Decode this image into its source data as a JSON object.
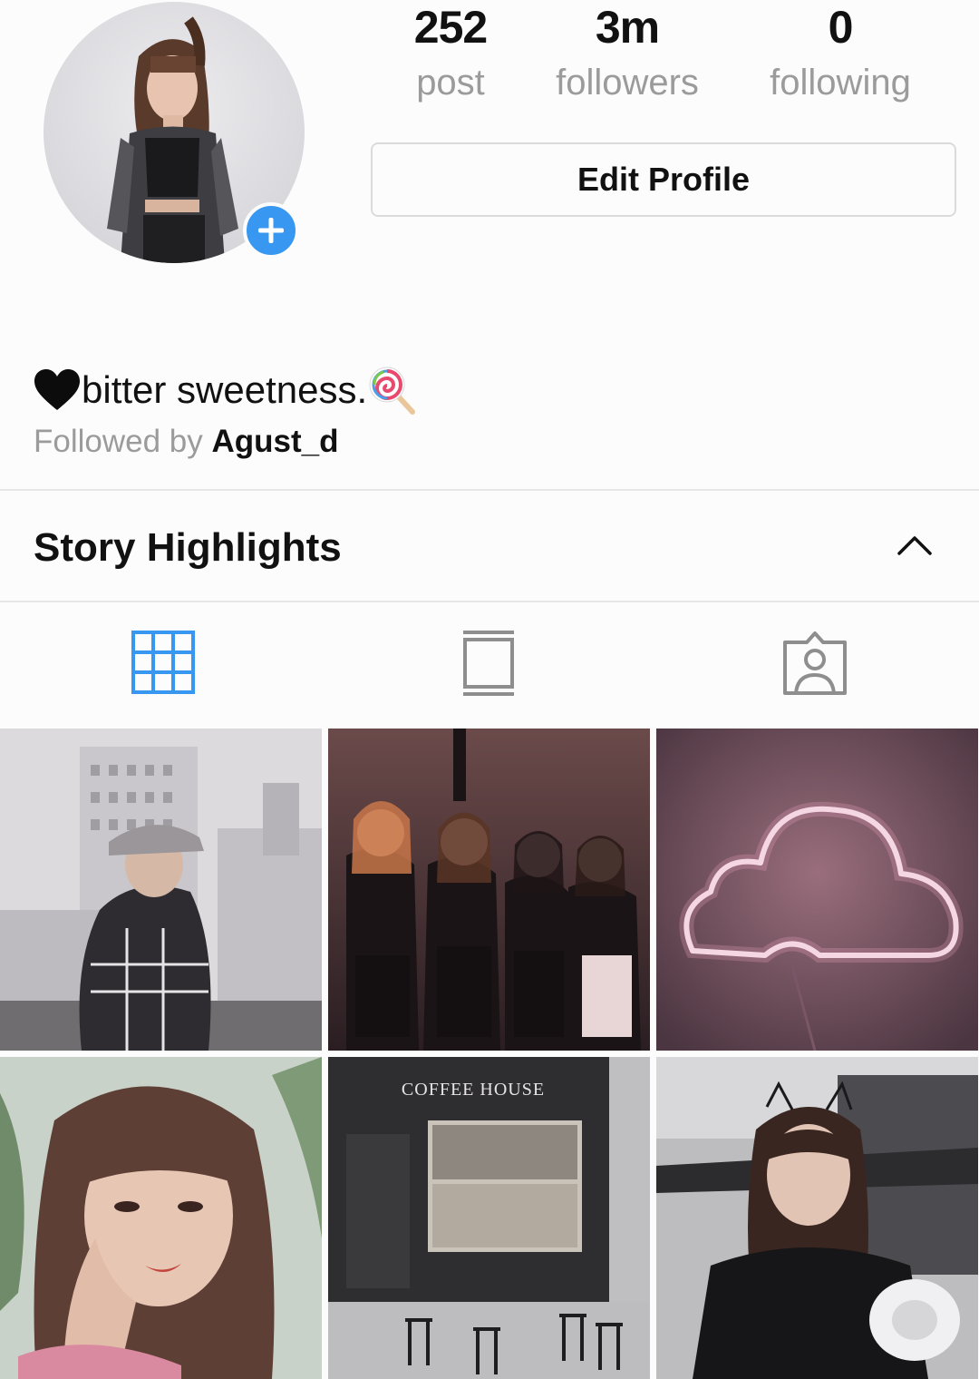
{
  "profile": {
    "stats": {
      "posts_count": "252",
      "posts_label": "post",
      "followers_count": "3m",
      "followers_label": "followers",
      "following_count": "0",
      "following_label": "following"
    },
    "edit_button": "Edit Profile",
    "bio": "bitter sweetness.",
    "bio_prefix_emoji": "black-heart",
    "bio_suffix_emoji": "lollipop",
    "followed_by_prefix": "Followed by ",
    "followed_by_user": "Agust_d"
  },
  "highlights": {
    "title": "Story Highlights",
    "expanded": true
  },
  "tabs": [
    {
      "name": "grid",
      "icon": "grid-icon",
      "active": true
    },
    {
      "name": "igtv",
      "icon": "tv-icon",
      "active": false
    },
    {
      "name": "tagged",
      "icon": "tagged-person-icon",
      "active": false
    }
  ],
  "posts": [
    {
      "description": "woman-in-cap-on-rooftop"
    },
    {
      "description": "group-of-four-performers"
    },
    {
      "description": "neon-cloud-sign"
    },
    {
      "description": "portrait-with-bangs"
    },
    {
      "description": "coffee-house-storefront",
      "sign_text": "COFFEE HOUSE"
    },
    {
      "description": "portrait-with-cat-ears"
    }
  ],
  "colors": {
    "accent_blue": "#3897f0",
    "muted_text": "#9b9b9b",
    "divider": "#e6e6e6"
  }
}
